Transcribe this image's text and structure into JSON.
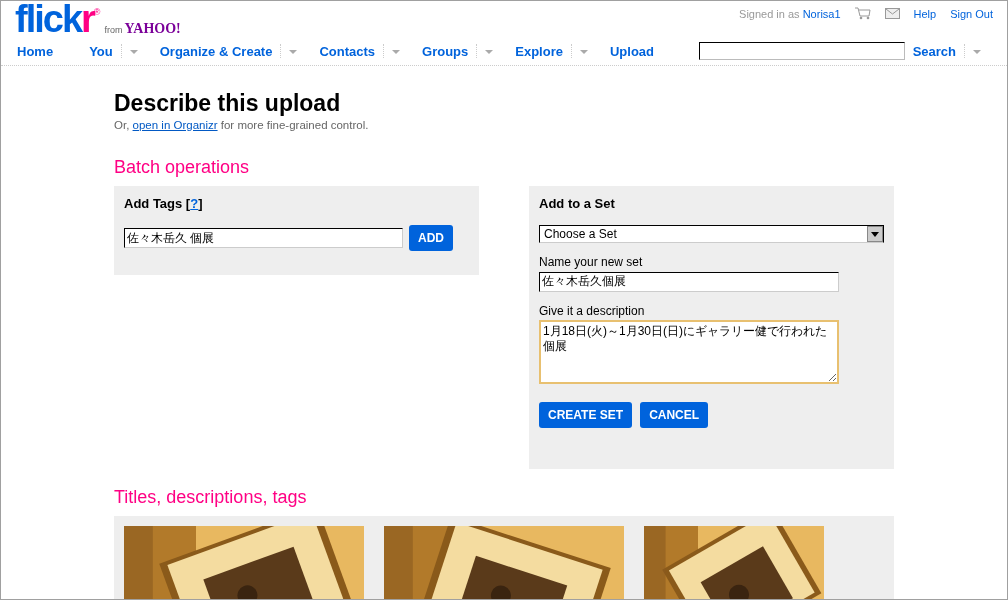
{
  "logo": {
    "main": "flick",
    "accent": "r",
    "mark": "®",
    "from": "from",
    "partner": "YAHOO!"
  },
  "account": {
    "prefix": "Signed in as",
    "user": "Norisa1",
    "links": [
      "Help",
      "Sign Out"
    ]
  },
  "nav": [
    {
      "label": "Home",
      "kind": "link"
    },
    {
      "label": "You",
      "kind": "menu"
    },
    {
      "label": "Organize & Create",
      "kind": "menu"
    },
    {
      "label": "Contacts",
      "kind": "menu"
    },
    {
      "label": "Groups",
      "kind": "menu"
    },
    {
      "label": "Explore",
      "kind": "menu"
    },
    {
      "label": "Upload",
      "kind": "link"
    }
  ],
  "search": {
    "button": "Search",
    "kind": "menu"
  },
  "title": "Describe this upload",
  "subtitle": {
    "before": "Or,",
    "link": "open in Organizr",
    "after": "for more fine-grained control."
  },
  "batch": {
    "heading": "Batch operations",
    "tags": {
      "label": "Add Tags [",
      "help": "?",
      "close": "]",
      "value": "佐々木岳久 個展",
      "button": "ADD"
    },
    "set": {
      "label": "Add to a Set",
      "select": "Choose a Set",
      "nameLabel": "Name your new set",
      "nameValue": "佐々木岳久個展",
      "descLabel": "Give it a description",
      "descValue": "1月18日(火)～1月30日(日)にギャラリー健で行われた個展",
      "descFocused": true,
      "buttons": [
        "CREATE SET",
        "CANCEL"
      ]
    }
  },
  "photos": {
    "heading": "Titles, descriptions, tags"
  }
}
